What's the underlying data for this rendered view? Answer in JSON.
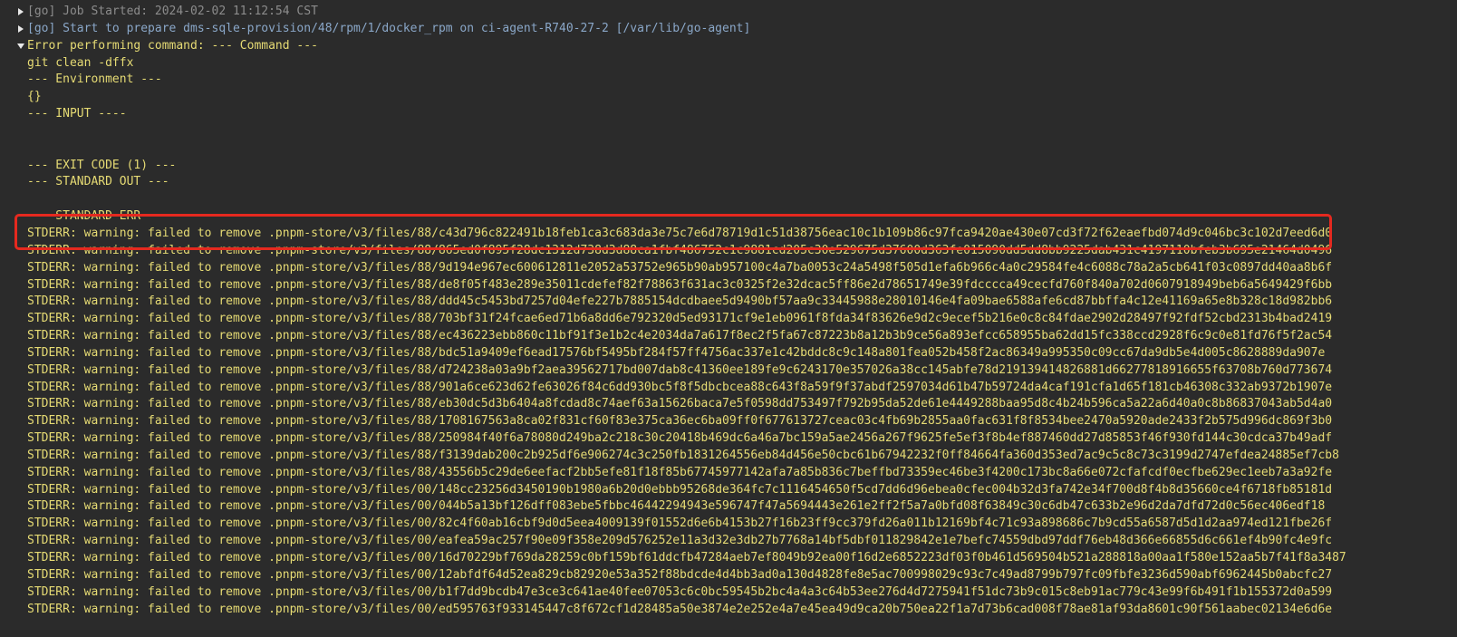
{
  "console": {
    "header_lines": [
      {
        "text": "[go] Job Started: 2024-02-02 11:12:54 CST",
        "style": "dim",
        "toggle": "collapsed"
      },
      {
        "text": "[go] Start to prepare dms-sqle-provision/48/rpm/1/docker_rpm on ci-agent-R740-27-2 [/var/lib/go-agent]",
        "style": "info",
        "toggle": "collapsed"
      },
      {
        "text": "Error performing command: --- Command ---",
        "style": "normal",
        "toggle": "expanded"
      }
    ],
    "body_lines": [
      "git clean -dffx",
      "--- Environment ---",
      "{}",
      "--- INPUT ----",
      "",
      "",
      "--- EXIT CODE (1) ---",
      "--- STANDARD OUT ---",
      "",
      "--- STANDARD ERR ---"
    ],
    "stderr_prefix": "STDERR: warning: failed to remove ",
    "stderr_paths": [
      ".pnpm-store/v3/files/88/c43d796c822491b18feb1ca3c683da3e75c7e6d78719d1c51d38756eac10c1b109b86c97fca9420ae430e07cd3f72f62eaefbd074d9c046bc3c102d7eed6d0",
      ".pnpm-store/v3/files/88/865ed0f895f28dc1312d738d3d88ca1fbf486752c1c9881cd205c30e529675d37600d363fe015090dd5dd8bb9225dab431c4197110bfeb3b695e21464d0496",
      ".pnpm-store/v3/files/88/9d194e967ec600612811e2052a53752e965b90ab957100c4a7ba0053c24a5498f505d1efa6b966c4a0c29584fe4c6088c78a2a5cb641f03c0897dd40aa8b6f",
      ".pnpm-store/v3/files/88/de8f05f483e289e35011cdefef82f78863f631ac3c0325f2e32dcac5ff86e2d78651749e39fdcccca49cecfd760f840a702d0607918949beb6a5649429f6bb",
      ".pnpm-store/v3/files/88/ddd45c5453bd7257d04efe227b7885154dcdbaee5d9490bf57aa9c33445988e28010146e4fa09bae6588afe6cd87bbffa4c12e41169a65e8b328c18d982bb6",
      ".pnpm-store/v3/files/88/703bf31f24fcae6ed71b6a8dd6e792320d5ed93171cf9e1eb0961f8fda34f83626e9d2c9ecef5b216e0c8c84fdae2902d28497f92fdf52cbd2313b4bad2419",
      ".pnpm-store/v3/files/88/ec436223ebb860c11bf91f3e1b2c4e2034da7a617f8ec2f5fa67c87223b8a12b3b9ce56a893efcc658955ba62dd15fc338ccd2928f6c9c0e81fd76f5f2ac54",
      ".pnpm-store/v3/files/88/bdc51a9409ef6ead17576bf5495bf284f57ff4756ac337e1c42bddc8c9c148a801fea052b458f2ac86349a995350c09cc67da9db5e4d005c8628889da907e",
      ".pnpm-store/v3/files/88/d724238a03a9bf2aea39562717bd007dab8c41360ee189fe9c6243170e357026a38cc145abfe78d219139414826881d66277818916655f63708b760d773674",
      ".pnpm-store/v3/files/88/901a6ce623d62fe63026f84c6dd930bc5f8f5dbcbcea88c643f8a59f9f37abdf2597034d61b47b59724da4caf191cfa1d65f181cb46308c332ab9372b1907e",
      ".pnpm-store/v3/files/88/eb30dc5d3b6404a8fcdad8c74aef63a15626baca7e5f0598dd753497f792b95da52de61e4449288baa95d8c4b24b596ca5a22a6d40a0c8b86837043ab5d4a0",
      ".pnpm-store/v3/files/88/1708167563a8ca02f831cf60f83e375ca36ec6ba09ff0f677613727ceac03c4fb69b2855aa0fac631f8f8534bee2470a5920ade2433f2b575d996dc869f3b0",
      ".pnpm-store/v3/files/88/250984f40f6a78080d249ba2c218c30c20418b469dc6a46a7bc159a5ae2456a267f9625fe5ef3f8b4ef887460dd27d85853f46f930fd144c30cdca37b49adf",
      ".pnpm-store/v3/files/88/f3139dab200c2b925df6e906274c3c250fb1831264556eb84d456e50cbc61b67942232f0ff84664fa360d353ed7ac9c5c8c73c3199d2747efdea24885ef7cb8",
      ".pnpm-store/v3/files/88/43556b5c29de6eefacf2bb5efe81f18f85b67745977142afa7a85b836c7beffbd73359ec46be3f4200c173bc8a66e072cfafcdf0ecfbe629ec1eeb7a3a92fe",
      ".pnpm-store/v3/files/00/148cc23256d3450190b1980a6b20d0ebbb95268de364fc7c1116454650f5cd7dd6d96ebea0cfec004b32d3fa742e34f700d8f4b8d35660ce4f6718fb85181d",
      ".pnpm-store/v3/files/00/044b5a13bf126dff083ebe5fbbc46442294943e596747f47a5694443e261e2ff2f5a7a0bfd08f63849c30c6db47c633b2e96d2da7dfd72d0c56ec406edf18",
      ".pnpm-store/v3/files/00/82c4f60ab16cbf9d0d5eea4009139f01552d6e6b4153b27f16b23ff9cc379fd26a011b12169bf4c71c93a898686c7b9cd55a6587d5d1d2aa974ed121fbe26f",
      ".pnpm-store/v3/files/00/eafea59ac257f90e09f358e209d576252e11a3d32e3db27b7768a14bf5dbf011829842e1e7befc74559dbd97ddf76eb48d366e66855d6c661ef4b90fc4e9fc",
      ".pnpm-store/v3/files/00/16d70229bf769da28259c0bf159bf61ddcfb47284aeb7ef8049b92ea00f16d2e6852223df03f0b461d569504b521a288818a00aa1f580e152aa5b7f41f8a3487",
      ".pnpm-store/v3/files/00/12abfdf64d52ea829cb82920e53a352f88bdcde4d4bb3ad0a130d4828fe8e5ac700998029c93c7c49ad8799b797fc09fbfe3236d590abf6962445b0abcfc27",
      ".pnpm-store/v3/files/00/b1f7dd9bcdb47e3ce3c641ae40fee07053c6c0bc59545b2bc4a4a3c64b53ee276d4d7275941f51dc73b9c015c8eb91ac779c43e99f6b491f1b155372d0a599",
      ".pnpm-store/v3/files/00/ed595763f933145447c8f672cf1d28485a50e3874e2e252e4a7e45ea49d9ca20b750ea22f1a7d73b6cad008f78ae81af93da8601c90f561aabec02134e6d6e"
    ]
  }
}
